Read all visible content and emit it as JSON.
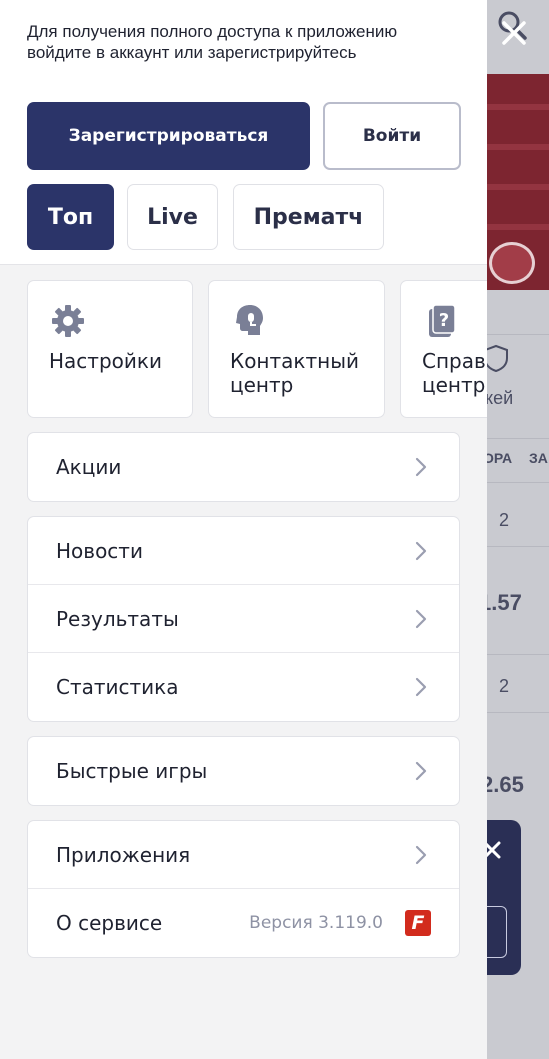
{
  "header": {
    "login_hint": "Для получения полного доступа к приложению войдите в аккаунт или зарегистрируйтесь",
    "register_label": "Зарегистрироваться",
    "login_label": "Войти"
  },
  "tabs": [
    {
      "label": "Топ",
      "active": true
    },
    {
      "label": "Live",
      "active": false
    },
    {
      "label": "Прематч",
      "active": false
    }
  ],
  "tiles": [
    {
      "label": "Настройки",
      "icon": "gear-icon"
    },
    {
      "label": "Контактный\nцентр",
      "icon": "support-head-icon"
    },
    {
      "label": "Справ\nцентр",
      "icon": "help-book-icon"
    }
  ],
  "menu": {
    "promo": [
      {
        "label": "Акции"
      }
    ],
    "info": [
      {
        "label": "Новости"
      },
      {
        "label": "Результаты"
      },
      {
        "label": "Статистика"
      }
    ],
    "games": [
      {
        "label": "Быстрые игры"
      }
    ],
    "app": [
      {
        "label": "Приложения"
      },
      {
        "label": "О сервисе",
        "version": "Версия 3.119.0",
        "logo_letter": "F"
      }
    ]
  },
  "background": {
    "hockey_label": "кей",
    "col_headers": [
      "ОРА",
      "ЗА"
    ],
    "values": [
      "2",
      "1.57",
      "2",
      "2.65"
    ]
  },
  "colors": {
    "accent": "#2b3469",
    "brand_logo": "#d22b1d",
    "drawer_bg": "#f3f3f4",
    "text": "#1f2230"
  }
}
